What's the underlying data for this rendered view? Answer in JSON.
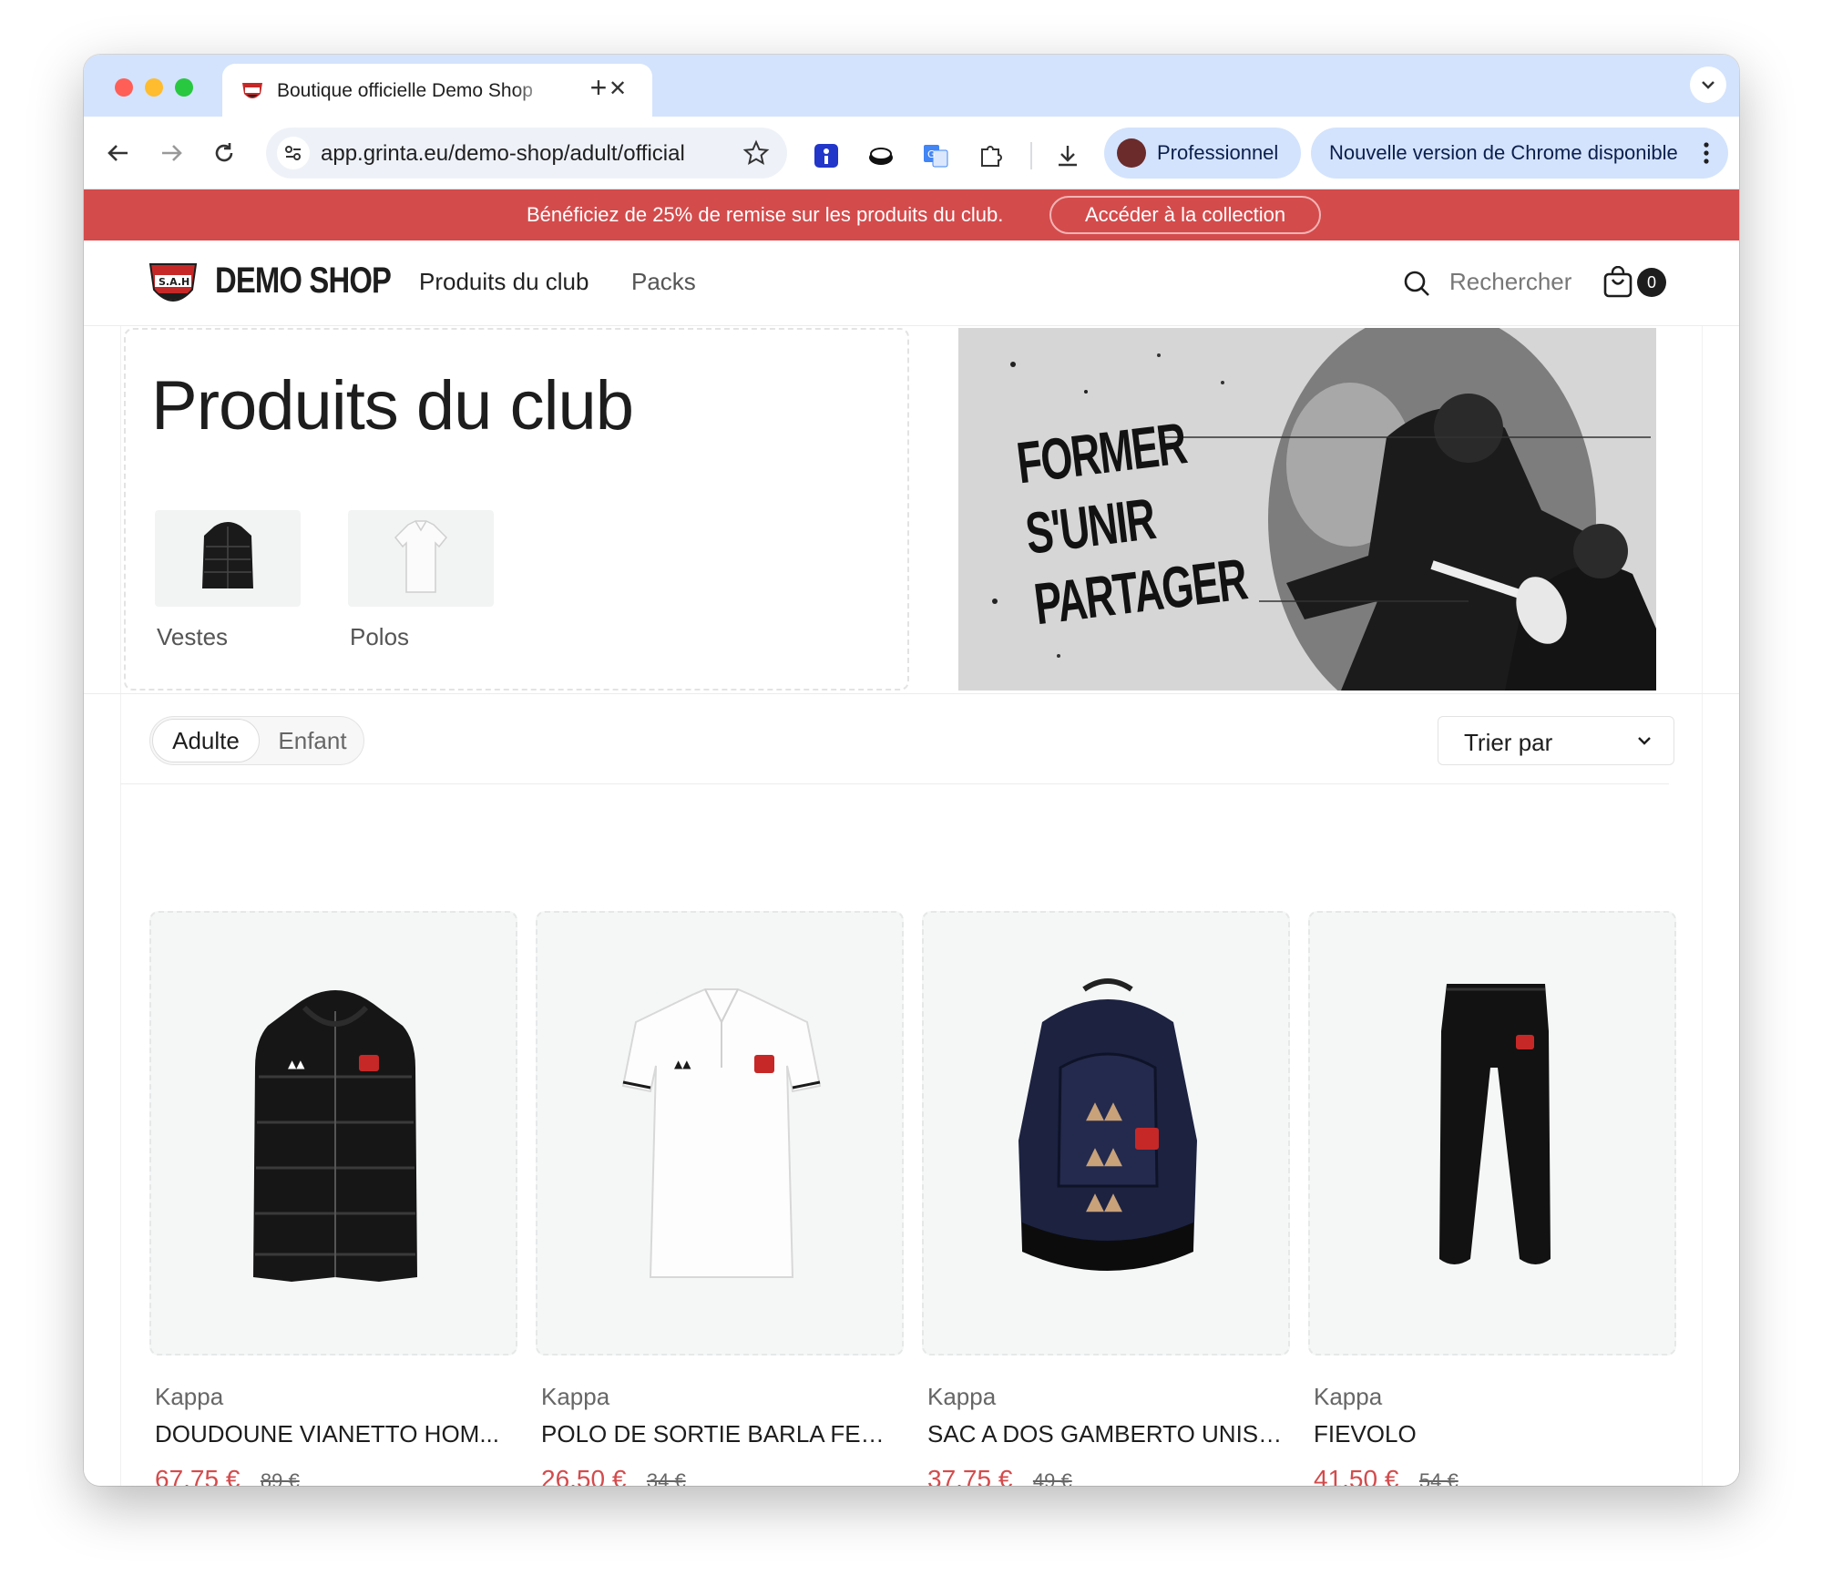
{
  "browser": {
    "tab_title": "Boutique officielle Demo Shop",
    "url": "app.grinta.eu/demo-shop/adult/official",
    "profile_label": "Professionnel",
    "update_label": "Nouvelle version de Chrome disponible"
  },
  "promo": {
    "text": "Bénéficiez de 25% de remise sur les produits du club.",
    "cta": "Accéder à la collection",
    "color": "#d44b4c"
  },
  "header": {
    "logo_text": "DEMO SHOP",
    "nav": [
      "Produits du club",
      "Packs"
    ],
    "search_label": "Rechercher",
    "cart_count": "0"
  },
  "hero": {
    "title": "Produits du club",
    "categories": [
      {
        "label": "Vestes",
        "icon": "jacket-thumbnail"
      },
      {
        "label": "Polos",
        "icon": "polo-thumbnail"
      }
    ],
    "banner_lines": [
      "FORMER",
      "S'UNIR",
      "PARTAGER"
    ]
  },
  "filters": {
    "audience_options": [
      "Adulte",
      "Enfant"
    ],
    "audience_selected": "Adulte",
    "sort_label": "Trier par"
  },
  "products": [
    {
      "brand": "Kappa",
      "name": "DOUDOUNE VIANETTO HOM...",
      "price": "67,75 €",
      "old_price": "89 €",
      "image": "black-puffer-jacket"
    },
    {
      "brand": "Kappa",
      "name": "POLO DE SORTIE BARLA FEM...",
      "price": "26,50 €",
      "old_price": "34 €",
      "image": "white-polo-shirt"
    },
    {
      "brand": "Kappa",
      "name": "SAC A DOS GAMBERTO UNISEX",
      "price": "37,75 €",
      "old_price": "49 €",
      "image": "navy-backpack"
    },
    {
      "brand": "Kappa",
      "name": "FIEVOLO",
      "price": "41,50 €",
      "old_price": "54 €",
      "image": "black-track-pants"
    }
  ]
}
